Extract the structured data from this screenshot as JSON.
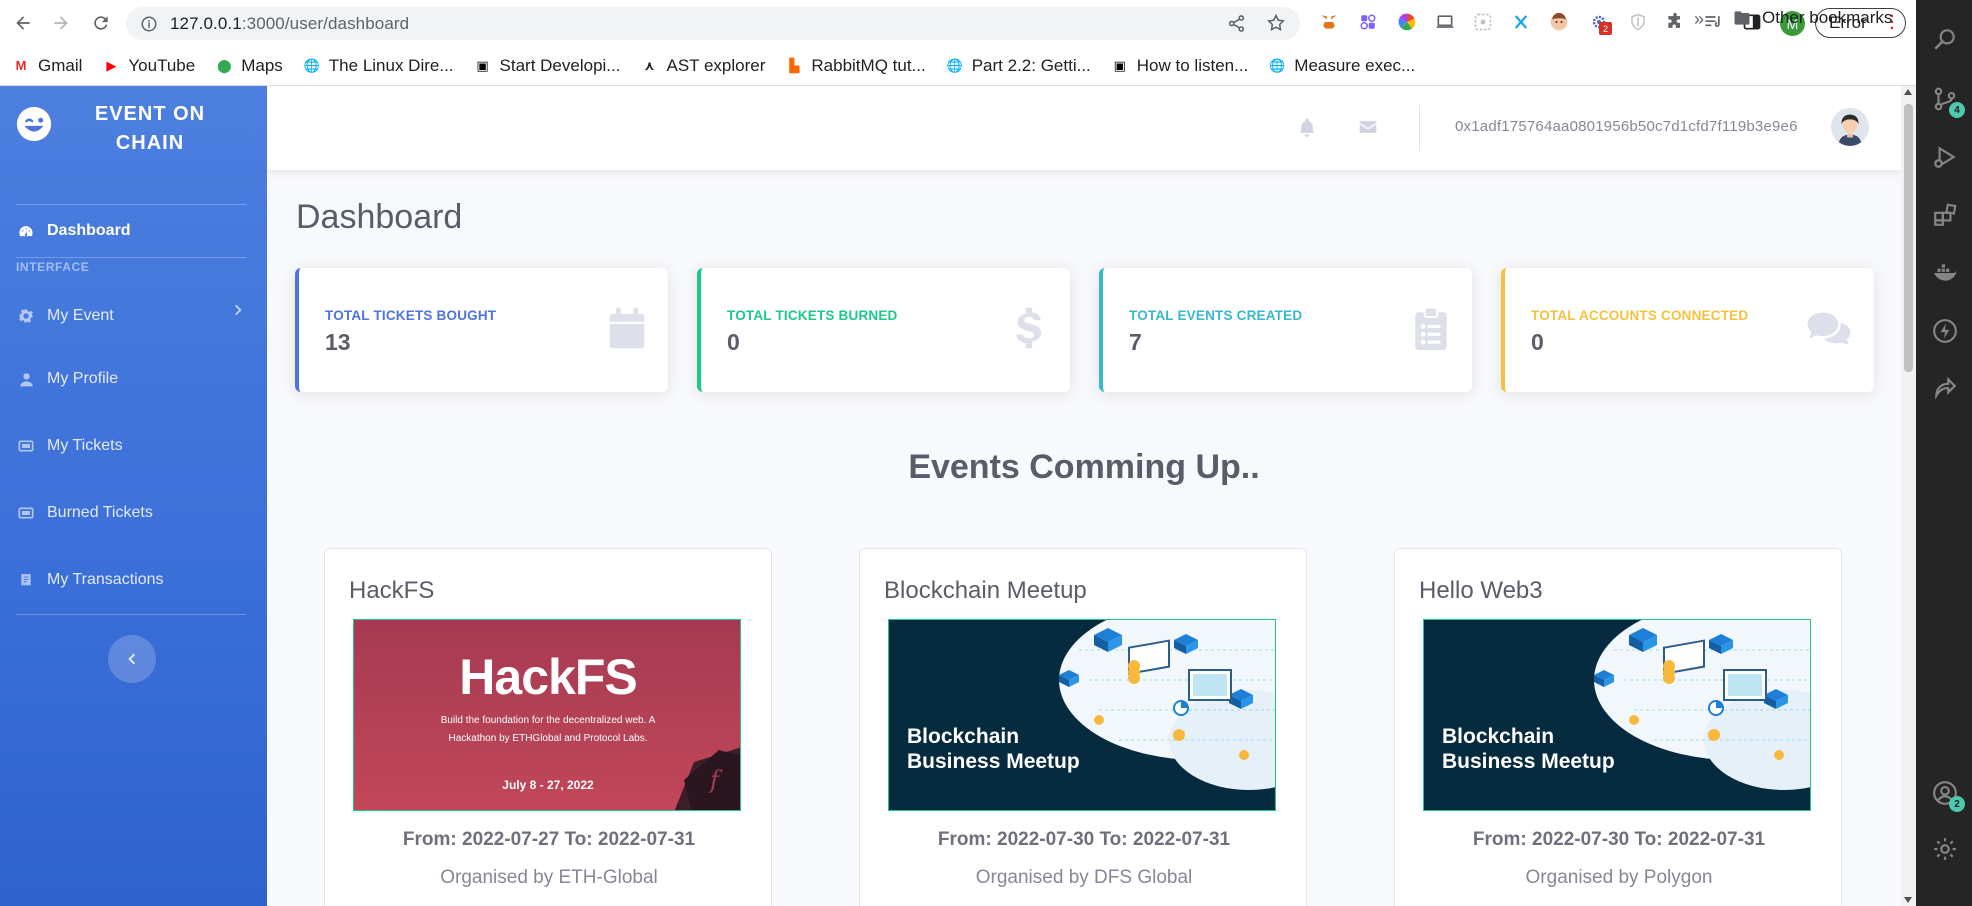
{
  "browser": {
    "url_host": "127.0.0.1",
    "url_path": ":3000/user/dashboard",
    "profile_initial": "M",
    "error_label": "Error",
    "ext_badge_count": "2",
    "bookmarks": [
      {
        "label": "Gmail",
        "icon": "gmail-icon",
        "color": "#d93025",
        "glyph": "M"
      },
      {
        "label": "YouTube",
        "icon": "youtube-icon",
        "color": "#ff0000",
        "glyph": "▶"
      },
      {
        "label": "Maps",
        "icon": "maps-pin-icon",
        "color": "#34a853",
        "glyph": "⬤"
      },
      {
        "label": "The Linux Dire...",
        "icon": "globe-icon",
        "color": "#5f6368",
        "glyph": "🌐"
      },
      {
        "label": "Start Developi...",
        "icon": "dev-icon",
        "color": "#000000",
        "glyph": "▣"
      },
      {
        "label": "AST explorer",
        "icon": "ast-icon",
        "color": "#202124",
        "glyph": "⋏"
      },
      {
        "label": "RabbitMQ tut...",
        "icon": "rabbitmq-icon",
        "color": "#ff6600",
        "glyph": "▙"
      },
      {
        "label": "Part 2.2: Getti...",
        "icon": "globe-icon",
        "color": "#5f6368",
        "glyph": "🌐"
      },
      {
        "label": "How to listen...",
        "icon": "dev-icon",
        "color": "#000000",
        "glyph": "▣"
      },
      {
        "label": "Measure exec...",
        "icon": "globe-icon",
        "color": "#5f6368",
        "glyph": "🌐"
      }
    ],
    "more_label": "»",
    "other_bookmarks": "Other bookmarks"
  },
  "sidebar": {
    "brand_line1": "EVENT ON",
    "brand_line2": "CHAIN",
    "dashboard_label": "Dashboard",
    "section_heading": "INTERFACE",
    "items": [
      {
        "label": "My Event"
      },
      {
        "label": "My Profile"
      },
      {
        "label": "My Tickets"
      },
      {
        "label": "Burned Tickets"
      },
      {
        "label": "My Transactions"
      }
    ]
  },
  "topbar": {
    "wallet_address": "0x1adf175764aa0801956b50c7d1cfd7f119b3e9e6"
  },
  "page": {
    "title": "Dashboard",
    "section_title": "Events Comming Up.."
  },
  "stats": [
    {
      "label": "TOTAL TICKETS BOUGHT",
      "value": "13",
      "color": "#4e73df",
      "icon": "calendar-icon"
    },
    {
      "label": "TOTAL TICKETS BURNED",
      "value": "0",
      "color": "#1cc88a",
      "icon": "dollar-icon"
    },
    {
      "label": "TOTAL EVENTS CREATED",
      "value": "7",
      "color": "#36b9cc",
      "icon": "clipboard-list-icon"
    },
    {
      "label": "TOTAL ACCOUNTS CONNECTED",
      "value": "0",
      "color": "#f6c23e",
      "icon": "comments-icon"
    }
  ],
  "events": [
    {
      "title": "HackFS",
      "image": {
        "headline": "HackFS",
        "subtitle_line1": "Build the foundation for the decentralized web. A",
        "subtitle_line2": "Hackathon by ETHGlobal and Protocol Labs.",
        "date": "July 8 - 27, 2022"
      },
      "dates": "From: 2022-07-27 To: 2022-07-31",
      "organiser": "Organised by ETH-Global"
    },
    {
      "title": "Blockchain Meetup",
      "image": {
        "line1": "Blockchain",
        "line2": "Business Meetup"
      },
      "dates": "From: 2022-07-30 To: 2022-07-31",
      "organiser": "Organised by DFS Global"
    },
    {
      "title": "Hello Web3",
      "image": {
        "line1": "Blockchain",
        "line2": "Business Meetup"
      },
      "dates": "From: 2022-07-30 To: 2022-07-31",
      "organiser": "Organised by Polygon"
    }
  ],
  "activity_bar": {
    "scm_badge": "4",
    "accounts_badge": "2"
  }
}
